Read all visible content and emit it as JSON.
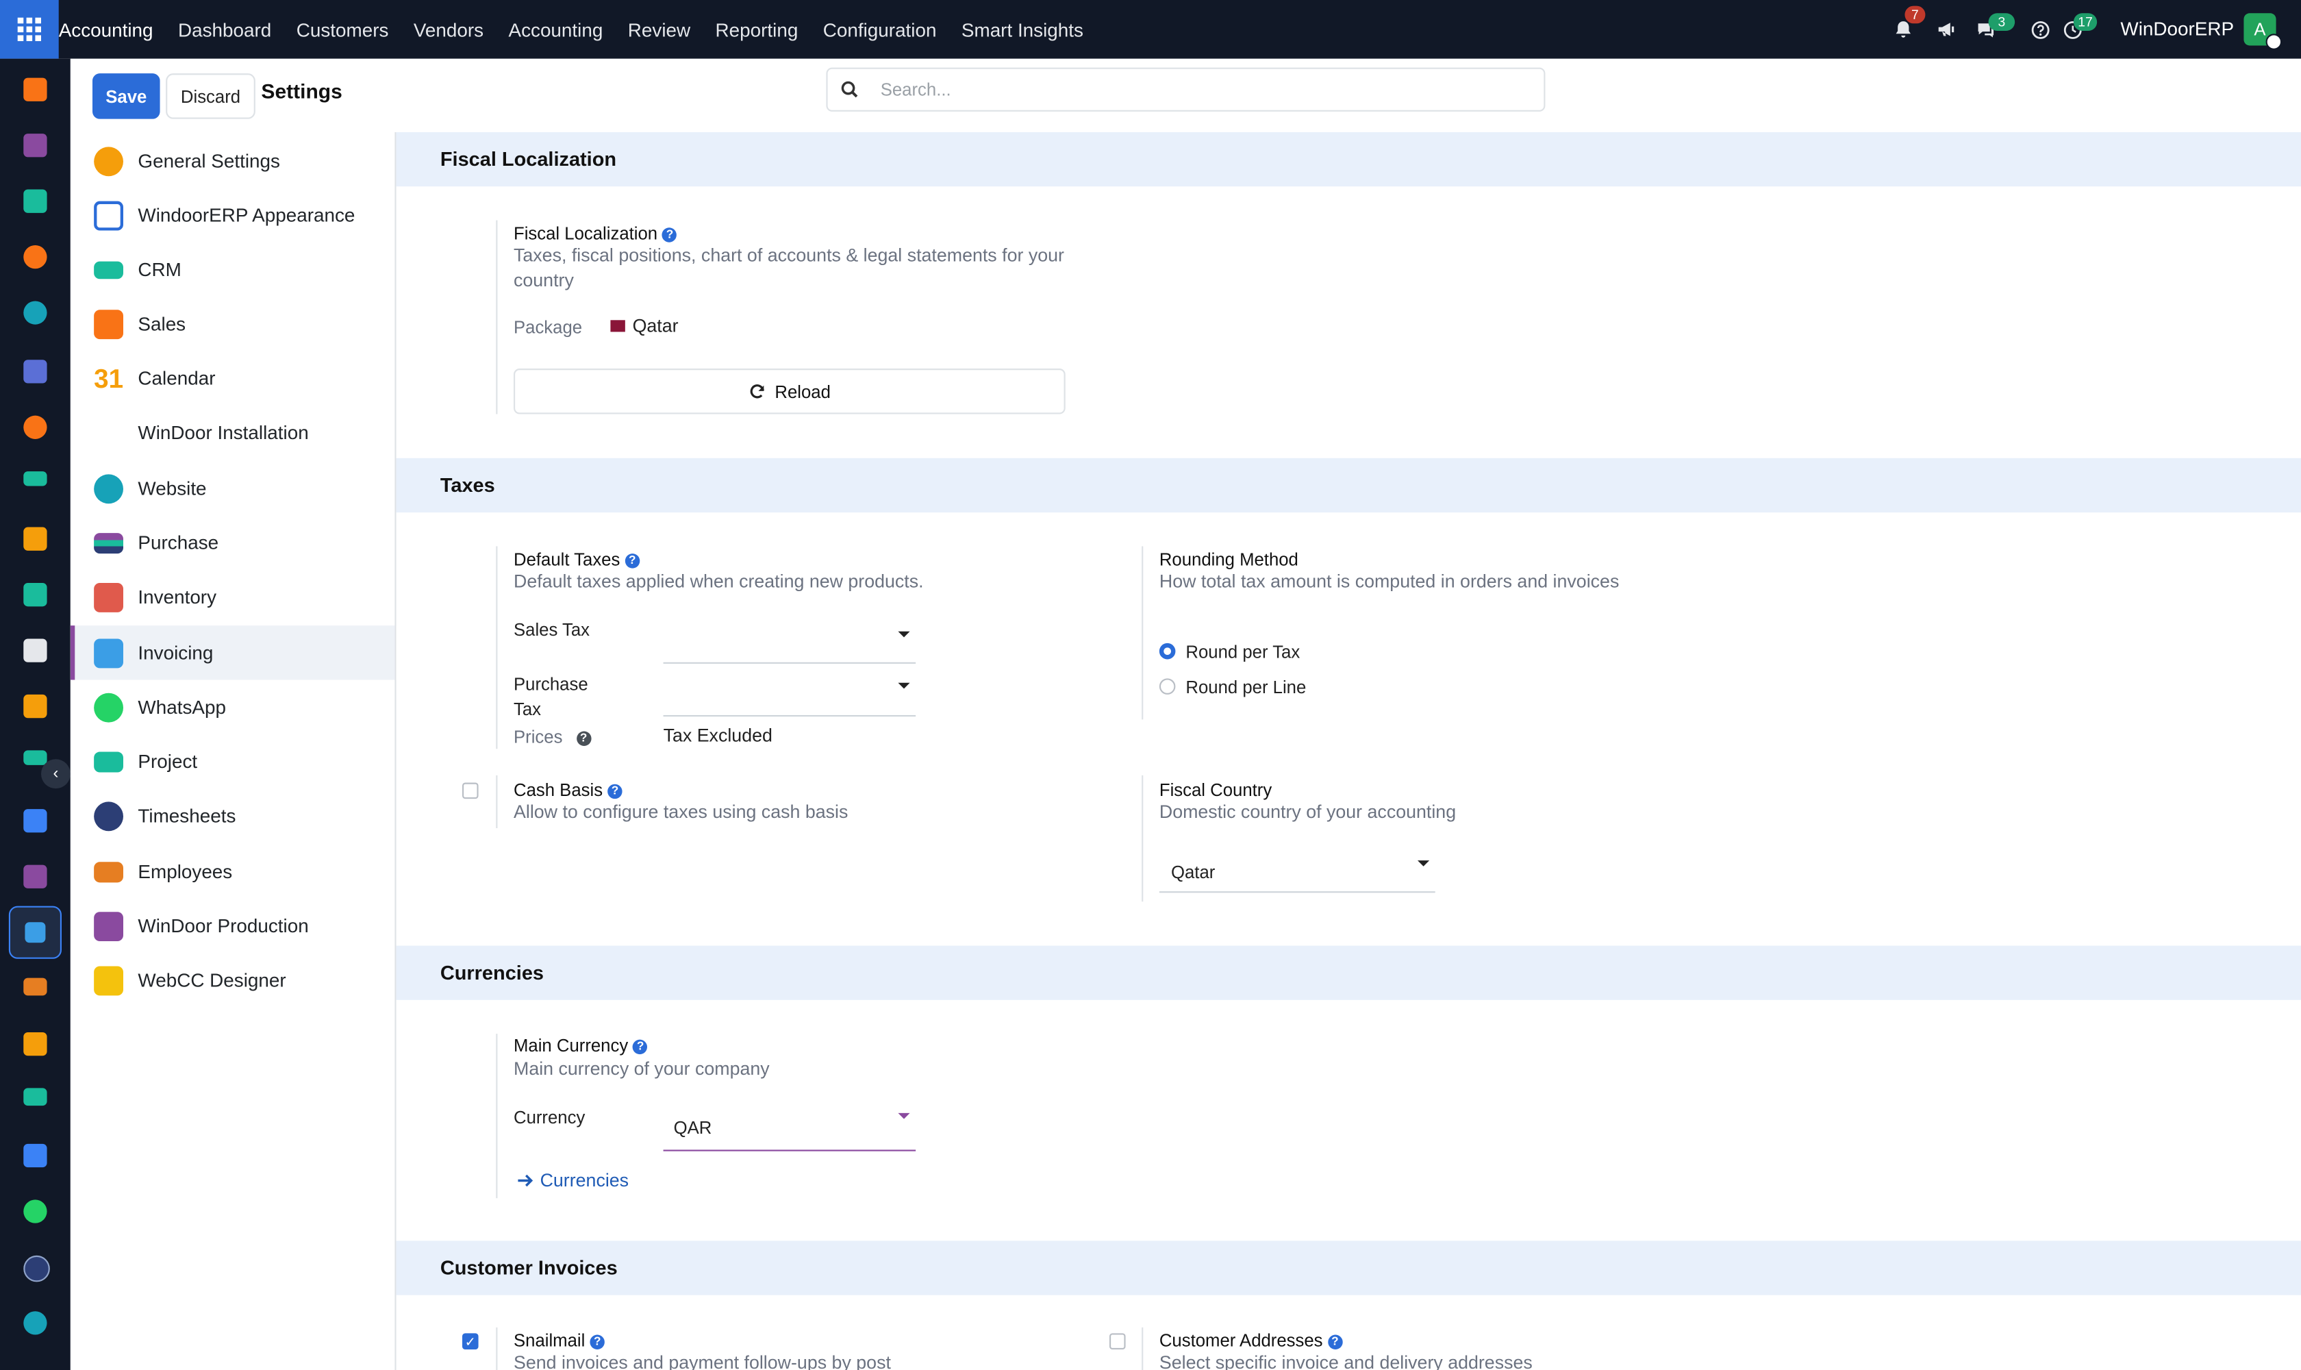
{
  "topbar": {
    "menu": [
      "Accounting",
      "Dashboard",
      "Customers",
      "Vendors",
      "Accounting",
      "Review",
      "Reporting",
      "Configuration",
      "Smart Insights"
    ],
    "notifications_badge": "7",
    "messages_badge": "3",
    "activities_badge": "17",
    "company": "WinDoorERP",
    "avatar_letter": "A"
  },
  "control_panel": {
    "save_label": "Save",
    "discard_label": "Discard",
    "title": "Settings",
    "search_placeholder": "Search..."
  },
  "sidebar": {
    "items": [
      {
        "label": "General Settings",
        "icon": "general-settings-icon",
        "color": "#f59e0b"
      },
      {
        "label": "WindoorERP Appearance",
        "icon": "appearance-icon",
        "color": "#2b6cd8"
      },
      {
        "label": "CRM",
        "icon": "crm-icon",
        "color": "#1abc9c"
      },
      {
        "label": "Sales",
        "icon": "sales-icon",
        "color": "#f97316"
      },
      {
        "label": "Calendar",
        "icon": "calendar-icon",
        "color": "#f59e0b"
      },
      {
        "label": "WinDoor Installation",
        "icon": "",
        "color": ""
      },
      {
        "label": "Website",
        "icon": "website-icon",
        "color": "#17a2b8"
      },
      {
        "label": "Purchase",
        "icon": "purchase-icon",
        "color": "#8a4a9f"
      },
      {
        "label": "Inventory",
        "icon": "inventory-icon",
        "color": "#e05a4c"
      },
      {
        "label": "Invoicing",
        "icon": "invoicing-icon",
        "color": "#3b9ee6"
      },
      {
        "label": "WhatsApp",
        "icon": "whatsapp-icon",
        "color": "#25d366"
      },
      {
        "label": "Project",
        "icon": "project-icon",
        "color": "#1abc9c"
      },
      {
        "label": "Timesheets",
        "icon": "timesheets-icon",
        "color": "#2c3e75"
      },
      {
        "label": "Employees",
        "icon": "employees-icon",
        "color": "#e67e22"
      },
      {
        "label": "WinDoor Production",
        "icon": "production-icon",
        "color": "#8a4a9f"
      },
      {
        "label": "WebCC Designer",
        "icon": "designer-icon",
        "color": "#f4c20d"
      }
    ],
    "active": "Invoicing"
  },
  "fiscal": {
    "section": "Fiscal Localization",
    "title": "Fiscal Localization",
    "desc": "Taxes, fiscal positions, chart of accounts & legal statements for your country",
    "package_label": "Package",
    "package_value": "Qatar",
    "reload_label": "Reload"
  },
  "taxes": {
    "section": "Taxes",
    "default_title": "Default Taxes",
    "default_desc": "Default taxes applied when creating new products.",
    "sales_tax_label": "Sales Tax",
    "sales_tax_value": "",
    "purchase_tax_label": "Purchase Tax",
    "purchase_tax_value": "",
    "prices_label": "Prices",
    "prices_value": "Tax Excluded",
    "rounding_title": "Rounding Method",
    "rounding_desc": "How total tax amount is computed in orders and invoices",
    "round_per_tax": "Round per Tax",
    "round_per_line": "Round per Line",
    "cash_basis_title": "Cash Basis",
    "cash_basis_desc": "Allow to configure taxes using cash basis",
    "fiscal_country_title": "Fiscal Country",
    "fiscal_country_desc": "Domestic country of your accounting",
    "fiscal_country_value": "Qatar"
  },
  "currencies": {
    "section": "Currencies",
    "title": "Main Currency",
    "desc": "Main currency of your company",
    "currency_label": "Currency",
    "currency_value": "QAR",
    "link_label": "Currencies"
  },
  "customer_invoices": {
    "section": "Customer Invoices",
    "snailmail_title": "Snailmail",
    "snailmail_desc": "Send invoices and payment follow-ups by post",
    "addresses_title": "Customer Addresses",
    "addresses_desc": "Select specific invoice and delivery addresses"
  }
}
